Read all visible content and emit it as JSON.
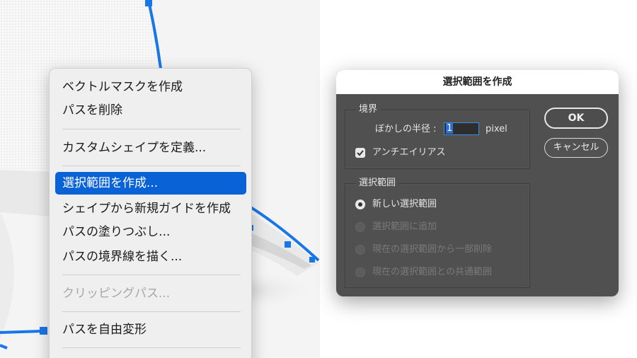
{
  "context_menu": {
    "items": [
      {
        "label": "ベクトルマスクを作成",
        "state": "normal"
      },
      {
        "label": "パスを削除",
        "state": "normal"
      },
      {
        "label": "カスタムシェイプを定義...",
        "state": "normal"
      },
      {
        "label": "選択範囲を作成...",
        "state": "selected"
      },
      {
        "label": "シェイプから新規ガイドを作成",
        "state": "normal"
      },
      {
        "label": "パスの塗りつぶし...",
        "state": "normal"
      },
      {
        "label": "パスの境界線を描く...",
        "state": "normal"
      },
      {
        "label": "クリッピングパス...",
        "state": "disabled"
      },
      {
        "label": "パスを自由変形",
        "state": "normal"
      }
    ]
  },
  "dialog": {
    "title": "選択範囲を作成",
    "border_group": {
      "label": "境界",
      "feather_label": "ぼかしの半径 :",
      "feather_value": "1",
      "feather_unit": "pixel",
      "antialias_label": "アンチエイリアス",
      "antialias_checked": true
    },
    "operation_group": {
      "label": "選択範囲",
      "options": [
        {
          "label": "新しい選択範囲",
          "selected": true,
          "enabled": true
        },
        {
          "label": "選択範囲に追加",
          "selected": false,
          "enabled": false
        },
        {
          "label": "現在の選択範囲から一部削除",
          "selected": false,
          "enabled": false
        },
        {
          "label": "現在の選択範囲との共通範囲",
          "selected": false,
          "enabled": false
        }
      ]
    },
    "ok_label": "OK",
    "cancel_label": "キャンセル"
  },
  "colors": {
    "path_blue": "#1877e8",
    "menu_highlight": "#0a63d6",
    "dialog_bg": "#505050"
  }
}
